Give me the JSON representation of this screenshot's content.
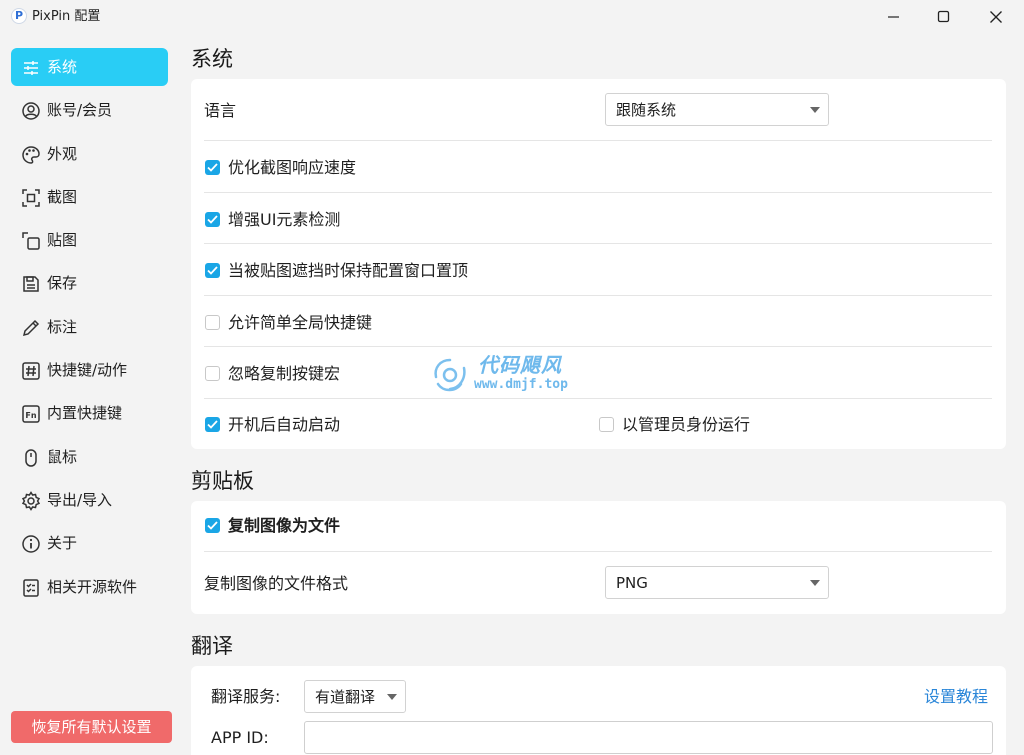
{
  "window": {
    "app_logo_letter": "P",
    "title": "PixPin 配置"
  },
  "sidebar": {
    "items": [
      {
        "label": "系统",
        "icon": "sliders-icon",
        "active": true
      },
      {
        "label": "账号/会员",
        "icon": "user-icon",
        "active": false
      },
      {
        "label": "外观",
        "icon": "palette-icon",
        "active": false
      },
      {
        "label": "截图",
        "icon": "screenshot-frame-icon",
        "active": false
      },
      {
        "label": "贴图",
        "icon": "pin-image-icon",
        "active": false
      },
      {
        "label": "保存",
        "icon": "save-icon",
        "active": false
      },
      {
        "label": "标注",
        "icon": "pencil-icon",
        "active": false
      },
      {
        "label": "快捷键/动作",
        "icon": "hash-icon",
        "active": false
      },
      {
        "label": "内置快捷键",
        "icon": "fn-key-icon",
        "active": false
      },
      {
        "label": "鼠标",
        "icon": "mouse-icon",
        "active": false
      },
      {
        "label": "导出/导入",
        "icon": "gear-icon",
        "active": false
      },
      {
        "label": "关于",
        "icon": "info-icon",
        "active": false
      },
      {
        "label": "相关开源软件",
        "icon": "checklist-icon",
        "active": false
      }
    ],
    "reset_label": "恢复所有默认设置"
  },
  "system": {
    "title": "系统",
    "language_label": "语言",
    "language_value": "跟随系统",
    "options": [
      {
        "label": "优化截图响应速度",
        "checked": true
      },
      {
        "label": "增强UI元素检测",
        "checked": true
      },
      {
        "label": "当被贴图遮挡时保持配置窗口置顶",
        "checked": true
      },
      {
        "label": "允许简单全局快捷键",
        "checked": false
      },
      {
        "label": "忽略复制按键宏",
        "checked": false
      },
      {
        "label": "开机后自动启动",
        "checked": true
      }
    ],
    "run_as_admin": {
      "label": "以管理员身份运行",
      "checked": false
    }
  },
  "clipboard": {
    "title": "剪贴板",
    "copy_as_file": {
      "label": "复制图像为文件",
      "checked": true
    },
    "format_label": "复制图像的文件格式",
    "format_value": "PNG"
  },
  "translate": {
    "title": "翻译",
    "service_label": "翻译服务:",
    "service_value": "有道翻译",
    "tutorial_link": "设置教程",
    "app_id_label": "APP ID:",
    "app_id_value": ""
  },
  "watermark": {
    "name": "代码飓风",
    "url": "www.dmjf.top"
  },
  "colors": {
    "accent": "#29cdf5",
    "checkbox_on": "#1aa6e6",
    "reset_button": "#f06a6a",
    "link": "#2a86d8"
  }
}
